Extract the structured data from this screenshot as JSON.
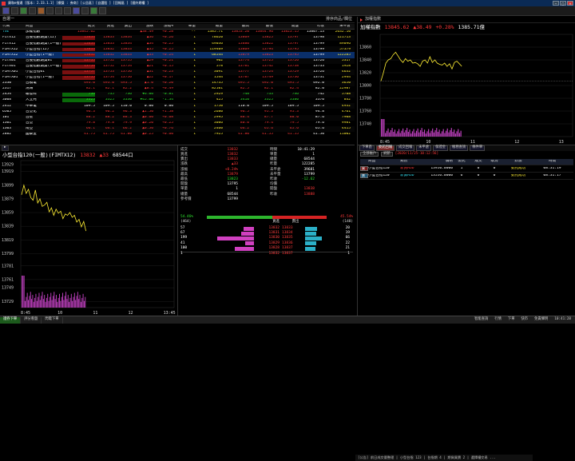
{
  "titlebar": {
    "title": "康和e指通 [版本: 2.33.1.1] [模擬 : 券商] [公告區] [自選股 ] [回報區 ] [國外期權 ]"
  },
  "toolbar": {
    "search_placeholder": "Q搜尋"
  },
  "quote_panel": {
    "title": "自選一",
    "right_label": "排序商品/欄位",
    "columns": [
      "代碼",
      "商品",
      "成交",
      "買進",
      "賣出",
      "漲跌",
      "漲幅%",
      "單量",
      "總量",
      "最高",
      "最低",
      "開盤",
      "昨收",
      "未平倉"
    ],
    "rows": [
      {
        "code": "TSE",
        "name": "加權指數",
        "last": "13845.62",
        "bid": "",
        "ask": "",
        "chg": "▲38.49",
        "pct": "+0.28",
        "vol": "--",
        "total": "1385.71",
        "high": "13853.20",
        "low": "13844.96",
        "open": "13823.15",
        "prev": "13807.13",
        "oi": "2632.10"
      },
      {
        "code": "FITX12",
        "name": "台股指數期貨(12)",
        "last": "13834",
        "bid": "13833",
        "ask": "13834",
        "chg": "▲36",
        "pct": "+0.26",
        "vol": "1",
        "total": "78620",
        "high": "13869",
        "low": "13825",
        "open": "13797",
        "prev": "13798",
        "oi": "121713"
      },
      {
        "code": "FITX12",
        "name": "台股指數期貨(1一般)",
        "last": "13834",
        "bid": "13833",
        "ask": "13834",
        "chg": "▲34",
        "pct": "+0.25",
        "vol": "1",
        "total": "49036",
        "high": "13880",
        "low": "13822",
        "open": "13797",
        "prev": "13799",
        "oi": "89096"
      },
      {
        "code": "FIMTX12",
        "name": "小型台指(12)",
        "last": "13833",
        "bid": "13832",
        "ask": "13833",
        "chg": "▲35",
        "pct": "+0.25",
        "vol": "1",
        "total": "119409",
        "high": "13869",
        "low": "13794",
        "open": "13795",
        "prev": "13799",
        "oi": "57379"
      },
      {
        "code": "FIMTX12",
        "name": "小型台指(1一般)",
        "last": "13832",
        "bid": "13832",
        "ask": "13833",
        "chg": "▲33",
        "pct": "+0.24",
        "vol": "1",
        "total": "68544",
        "high": "13879",
        "low": "13823",
        "open": "13795",
        "prev": "13799",
        "oi": "122285"
      },
      {
        "code": "FITX01",
        "name": "台股指數期貨01",
        "last": "13755",
        "bid": "13752",
        "ask": "13755",
        "chg": "▲29",
        "pct": "+0.21",
        "vol": "1",
        "total": "902",
        "high": "13774",
        "low": "13725",
        "open": "13726",
        "prev": "13726",
        "oi": "5317"
      },
      {
        "code": "FITX01",
        "name": "台股指數期貨(1一般)",
        "last": "13754",
        "bid": "13752",
        "ask": "13754",
        "chg": "▲21",
        "pct": "+0.15",
        "vol": "1",
        "total": "578",
        "high": "13781",
        "low": "13742",
        "open": "13738",
        "prev": "13733",
        "oi": "1928"
      },
      {
        "code": "FIMTX01",
        "name": "小型台指01",
        "last": "13757",
        "bid": "13753",
        "ask": "13756",
        "chg": "▲31",
        "pct": "+0.23",
        "vol": "1",
        "total": "3091",
        "high": "13777",
        "low": "13724",
        "open": "13729",
        "prev": "13726",
        "oi": "4632"
      },
      {
        "code": "FIMTX01",
        "name": "小型台指(1一般)",
        "last": "13755",
        "bid": "13754",
        "ask": "13756",
        "chg": "▲22",
        "pct": "+0.17",
        "vol": "1",
        "total": "1544",
        "high": "13787",
        "low": "13749",
        "open": "13736",
        "prev": "13731",
        "oi": "2944"
      },
      {
        "code": "2330",
        "name": "台積電",
        "last": "493.0",
        "bid": "493.0",
        "ask": "493.5",
        "chg": "▲1.0",
        "pct": "+0.20",
        "vol": "1",
        "total": "14735",
        "high": "495.5",
        "low": "492.0",
        "open": "495.5",
        "prev": "492.0",
        "oi": "3650"
      },
      {
        "code": "2317",
        "name": "鴻海",
        "last": "82.1",
        "bid": "82.1",
        "ask": "82.2",
        "chg": "▲0.4",
        "pct": "+0.49",
        "vol": "1",
        "total": "82101",
        "high": "82.5",
        "low": "82.1",
        "open": "82.4",
        "prev": "82.0",
        "oi": "22987"
      },
      {
        "code": "2454",
        "name": "聯發科",
        "last": "736",
        "bid": "735",
        "ask": "736",
        "chg": "▼6.00",
        "pct": "-0.81",
        "vol": "1",
        "total": "2929",
        "high": "748",
        "low": "733",
        "open": "746",
        "prev": "742",
        "oi": "5788"
      },
      {
        "code": "3008",
        "name": "大立光",
        "last": "3325",
        "bid": "3325",
        "ask": "3330",
        "chg": "▼45.00",
        "pct": "-1.34",
        "vol": "1",
        "total": "425",
        "high": "3410",
        "low": "3325",
        "open": "3380",
        "prev": "3370",
        "oi": "842"
      },
      {
        "code": "2412",
        "name": "中華電",
        "last": "109.5",
        "bid": "109.5",
        "ask": "110.0",
        "chg": "0.00",
        "pct": "0.00",
        "vol": "1",
        "total": "1750",
        "high": "110.0",
        "low": "109.5",
        "open": "109.5",
        "prev": "109.5",
        "oi": "4932"
      },
      {
        "code": "6505",
        "name": "台塑化",
        "last": "96.3",
        "bid": "96.2",
        "ask": "96.3",
        "chg": "▲1.50",
        "pct": "+1.58",
        "vol": "1",
        "total": "2680",
        "high": "96.5",
        "low": "95.3",
        "open": "95.3",
        "prev": "94.8",
        "oi": "4761"
      },
      {
        "code": "101",
        "name": "台壁",
        "last": "88.2",
        "bid": "88.2",
        "ask": "88.3",
        "chg": "▲0.60",
        "pct": "+0.68",
        "vol": "1",
        "total": "2995",
        "high": "88.4",
        "low": "87.7",
        "open": "88.0",
        "prev": "87.6",
        "oi": "7908"
      },
      {
        "code": "1301",
        "name": "台塑",
        "last": "79.8",
        "bid": "79.8",
        "ask": "79.9",
        "chg": "▲0.20",
        "pct": "+0.25",
        "vol": "1",
        "total": "3086",
        "high": "80.0",
        "low": "79.4",
        "open": "79.5",
        "prev": "79.6",
        "oi": "9981"
      },
      {
        "code": "1303",
        "name": "南亞",
        "last": "66.1",
        "bid": "66.1",
        "ask": "66.2",
        "chg": "▲0.50",
        "pct": "+0.76",
        "vol": "1",
        "total": "2460",
        "high": "66.2",
        "low": "65.6",
        "open": "65.6",
        "prev": "65.6",
        "oi": "4415"
      },
      {
        "code": "2882",
        "name": "國泰金",
        "last": "41.75",
        "bid": "41.75",
        "ask": "41.80",
        "chg": "▲0.25",
        "pct": "+0.60",
        "vol": "1",
        "total": "7925",
        "high": "41.80",
        "low": "41.55",
        "open": "41.55",
        "prev": "41.50",
        "oi": "11002"
      }
    ]
  },
  "index_panel": {
    "title": "加權指數",
    "name": "加權指數",
    "price": "13845.62",
    "change": "▲38.49",
    "pct": "+0.28%",
    "amount": "1385.71億",
    "y_ticks": [
      "13860",
      "13840",
      "13820",
      "13800",
      "13780",
      "13760",
      "13740"
    ],
    "x_ticks": [
      "8:45",
      "10",
      "11",
      "12",
      "13"
    ]
  },
  "chart_data": [
    {
      "type": "line",
      "title": "加權指數",
      "x_range": [
        "09:00",
        "13:30"
      ],
      "ylim": [
        13720,
        13880
      ],
      "reference": 13807.13,
      "series": [
        {
          "values": [
            13807,
            13820,
            13835,
            13840,
            13842,
            13848,
            13852,
            13846,
            13840,
            13836,
            13842,
            13838,
            13840,
            13835,
            13836,
            13834,
            13830,
            13838,
            13840,
            13835,
            13845,
            13836,
            13840,
            13835,
            13833,
            13832,
            13835,
            13830,
            13834,
            13826,
            13836,
            13838,
            13834,
            13830
          ]
        }
      ]
    },
    {
      "type": "line",
      "title": "小型台指120(一般)(FIMTX12)",
      "ylim": [
        13720,
        13935
      ],
      "series": [
        {
          "values": [
            13885,
            13899,
            13887,
            13893,
            13881,
            13877,
            13892,
            13873,
            13879,
            13868,
            13870,
            13874,
            13860,
            13866,
            13855,
            13864,
            13858,
            13861,
            13850,
            13857,
            13855,
            13859,
            13852,
            13855,
            13845,
            13849,
            13838,
            13846,
            13832
          ]
        }
      ]
    }
  ],
  "futures_panel": {
    "title": "小型台指120(一般)(FIMTX12)",
    "price": "13832",
    "change": "▲33",
    "volume": "68544口",
    "y_ticks": [
      "13929",
      "13919",
      "13899",
      "13879",
      "13859",
      "13839",
      "13819",
      "13799",
      "13781",
      "13761",
      "13749",
      "13729"
    ],
    "x_ticks": [
      "8:45",
      "10",
      "11",
      "12",
      "13:45"
    ]
  },
  "quote5": {
    "left_labels": [
      "成交",
      "買進",
      "賣出",
      "漲跌",
      "漲幅",
      "最高",
      "最低",
      "開盤",
      "單量",
      "總量",
      "參考價"
    ],
    "left_values": [
      "13832",
      "13832",
      "13833",
      "▲33",
      "+0.24%",
      "13879",
      "13823",
      "13795",
      "1",
      "68544",
      "13799"
    ],
    "right_labels": [
      "時間",
      "單量",
      "總量",
      "昨量",
      "未平倉",
      "未平量",
      "昨收",
      "均價",
      "開盤",
      "昨收"
    ],
    "right_values": [
      "10:41:29",
      "1",
      "68544",
      "122285",
      "39681",
      "13799",
      "-12.62",
      "",
      "13838",
      "13888"
    ],
    "extra": {
      "label1": "漲跌",
      "v1": "-12.62",
      "label2": "均價"
    },
    "time": "10:41:29",
    "pair1": [
      "13832",
      "1",
      "68544",
      "122285",
      "39681",
      "13799"
    ],
    "ratio_buy": "54.46%",
    "ratio_sell": "45.54%",
    "ratio_buy_frac": 0.5446,
    "depth_header": {
      "left": "(464)",
      "buy": "買進",
      "sell": "賣出",
      "right": "(148)"
    },
    "depth": [
      {
        "bvol": "57",
        "bid": "13832",
        "ask": "13833",
        "svol": "20",
        "bfrac": 0.25,
        "sfrac": 0.55
      },
      {
        "bvol": "67",
        "bid": "13831",
        "ask": "13834",
        "svol": "19",
        "bfrac": 0.3,
        "sfrac": 0.5
      },
      {
        "bvol": "199",
        "bid": "13830",
        "ask": "13835",
        "svol": "66",
        "bfrac": 0.85,
        "sfrac": 0.75
      },
      {
        "bvol": "41",
        "bid": "13829",
        "ask": "13836",
        "svol": "22",
        "bfrac": 0.2,
        "sfrac": 0.5
      },
      {
        "bvol": "100",
        "bid": "13828",
        "ask": "13837",
        "svol": "21",
        "bfrac": 0.45,
        "sfrac": 0.45
      }
    ],
    "last_line": {
      "left": "1",
      "bid": "13832",
      "ask": "13837",
      "right": "1"
    }
  },
  "orders_panel": {
    "tabs": [
      "下單區",
      "委託回報",
      "成交回報",
      "未平倉",
      "保證金",
      "帳務查詢",
      "條件單"
    ],
    "date_range": "[2020/11/25-10:12:56]",
    "columns": [
      "",
      "商品",
      "類別",
      "價格",
      "委託",
      "成交",
      "取消",
      "狀態",
      "時間"
    ],
    "rows": [
      {
        "side": "買",
        "product": "小型台指120",
        "type": "新買ROD",
        "price": "13950.0000",
        "qty": "1",
        "filled": "0",
        "cancel": "0",
        "status": "委託成功",
        "time": "08:31:19"
      },
      {
        "side": "賣",
        "product": "小型台指120",
        "type": "新賣ROD",
        "price": "13556.0000",
        "qty": "6",
        "filled": "0",
        "cancel": "0",
        "status": "委託成功",
        "time": "08:31:17"
      }
    ],
    "filter_label": "全部帳戶",
    "refresh_label": "刷新"
  },
  "status": {
    "tabs": [
      "證券下單",
      "評分看盤",
      "閃電下單"
    ],
    "right": [
      "智能查詢",
      "行情",
      "下單",
      "快市",
      "免責聲明",
      "10:41:28"
    ]
  },
  "ticker": {
    "text": "[公告] 前日成交量整理 | 小型台指 123 | 台指期 4 | 期貨買賣 2 | 選擇權交易 ..."
  },
  "colors": {
    "up": "#ff3838",
    "down": "#2ee82e",
    "price_line": "#ffee33",
    "volume": "#c040c0"
  }
}
